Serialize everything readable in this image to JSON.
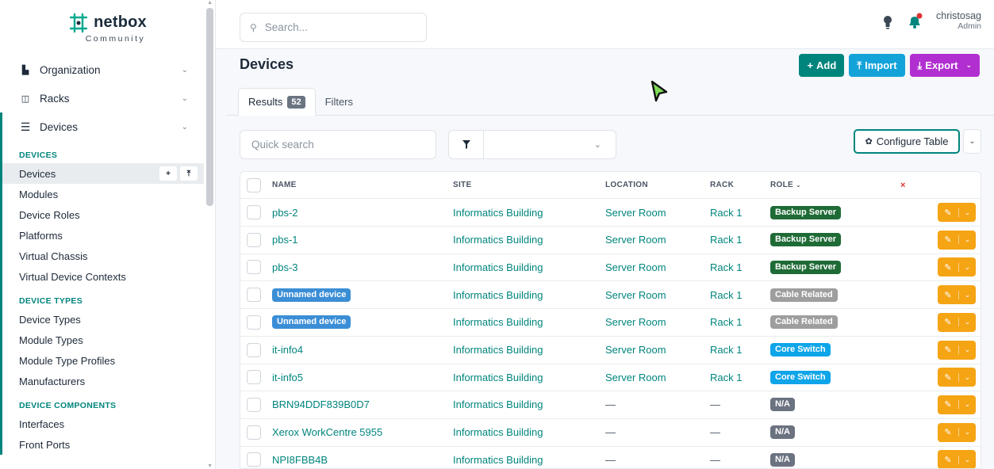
{
  "brand": {
    "name": "netbox",
    "subtitle": "Community"
  },
  "sidebar": {
    "groups": [
      {
        "label": "Organization",
        "icon": "building-icon"
      },
      {
        "label": "Racks",
        "icon": "rack-icon"
      },
      {
        "label": "Devices",
        "icon": "server-icon"
      }
    ],
    "sections": [
      {
        "title": "DEVICES",
        "items": [
          "Devices",
          "Modules",
          "Device Roles",
          "Platforms",
          "Virtual Chassis",
          "Virtual Device Contexts"
        ]
      },
      {
        "title": "DEVICE TYPES",
        "items": [
          "Device Types",
          "Module Types",
          "Module Type Profiles",
          "Manufacturers"
        ]
      },
      {
        "title": "DEVICE COMPONENTS",
        "items": [
          "Interfaces",
          "Front Ports"
        ]
      }
    ],
    "selected_item": "Devices"
  },
  "header": {
    "search_placeholder": "Search...",
    "user_name": "christosag",
    "user_role": "Admin"
  },
  "page": {
    "title": "Devices",
    "add_label": "Add",
    "import_label": "Import",
    "export_label": "Export"
  },
  "tabs": {
    "results_label": "Results",
    "results_count": "52",
    "filters_label": "Filters"
  },
  "toolbar": {
    "quick_search_placeholder": "Quick search",
    "configure_table_label": "Configure Table"
  },
  "table": {
    "columns": [
      "NAME",
      "SITE",
      "LOCATION",
      "RACK",
      "ROLE",
      "×"
    ],
    "rows": [
      {
        "name": "pbs-2",
        "name_style": "link",
        "site": "Informatics Building",
        "location": "Server Room",
        "rack": "Rack 1",
        "role": "Backup Server",
        "role_color": "#1f6b36"
      },
      {
        "name": "pbs-1",
        "name_style": "link",
        "site": "Informatics Building",
        "location": "Server Room",
        "rack": "Rack 1",
        "role": "Backup Server",
        "role_color": "#1f6b36"
      },
      {
        "name": "pbs-3",
        "name_style": "link",
        "site": "Informatics Building",
        "location": "Server Room",
        "rack": "Rack 1",
        "role": "Backup Server",
        "role_color": "#1f6b36"
      },
      {
        "name": "Unnamed device",
        "name_style": "pill",
        "site": "Informatics Building",
        "location": "Server Room",
        "rack": "Rack 1",
        "role": "Cable Related",
        "role_color": "#9e9e9e"
      },
      {
        "name": "Unnamed device",
        "name_style": "pill",
        "site": "Informatics Building",
        "location": "Server Room",
        "rack": "Rack 1",
        "role": "Cable Related",
        "role_color": "#9e9e9e"
      },
      {
        "name": "it-info4",
        "name_style": "link",
        "site": "Informatics Building",
        "location": "Server Room",
        "rack": "Rack 1",
        "role": "Core Switch",
        "role_color": "#0ea5e9"
      },
      {
        "name": "it-info5",
        "name_style": "link",
        "site": "Informatics Building",
        "location": "Server Room",
        "rack": "Rack 1",
        "role": "Core Switch",
        "role_color": "#0ea5e9"
      },
      {
        "name": "BRN94DDF839B0D7",
        "name_style": "link",
        "site": "Informatics Building",
        "location": "—",
        "rack": "—",
        "role": "N/A",
        "role_color": "#6b7280"
      },
      {
        "name": "Xerox WorkCentre 5955",
        "name_style": "link",
        "site": "Informatics Building",
        "location": "—",
        "rack": "—",
        "role": "N/A",
        "role_color": "#6b7280"
      },
      {
        "name": "NPI8FBB4B",
        "name_style": "link",
        "site": "Informatics Building",
        "location": "—",
        "rack": "—",
        "role": "N/A",
        "role_color": "#6b7280"
      }
    ]
  },
  "colors": {
    "accent": "#00857d",
    "import": "#14a3d9",
    "export": "#b12fd0",
    "row_action": "#f5a414"
  }
}
